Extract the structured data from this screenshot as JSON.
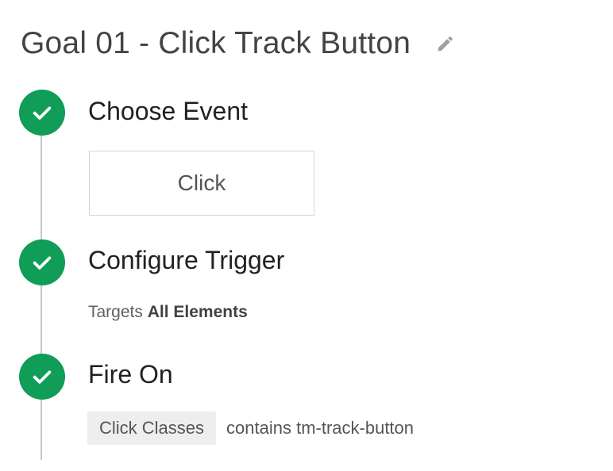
{
  "header": {
    "title": "Goal 01 - Click Track Button",
    "edit_icon": "pencil-icon"
  },
  "steps": [
    {
      "title": "Choose Event",
      "status_icon": "check-circle-icon",
      "event_value": "Click"
    },
    {
      "title": "Configure Trigger",
      "status_icon": "check-circle-icon",
      "targets_label": "Targets",
      "targets_value": "All Elements"
    },
    {
      "title": "Fire On",
      "status_icon": "check-circle-icon",
      "condition_variable": "Click Classes",
      "condition_text": "contains tm-track-button"
    }
  ],
  "colors": {
    "success": "#0f9d58",
    "timeline": "#c8c8c8",
    "chip_background": "#eeeeee"
  }
}
